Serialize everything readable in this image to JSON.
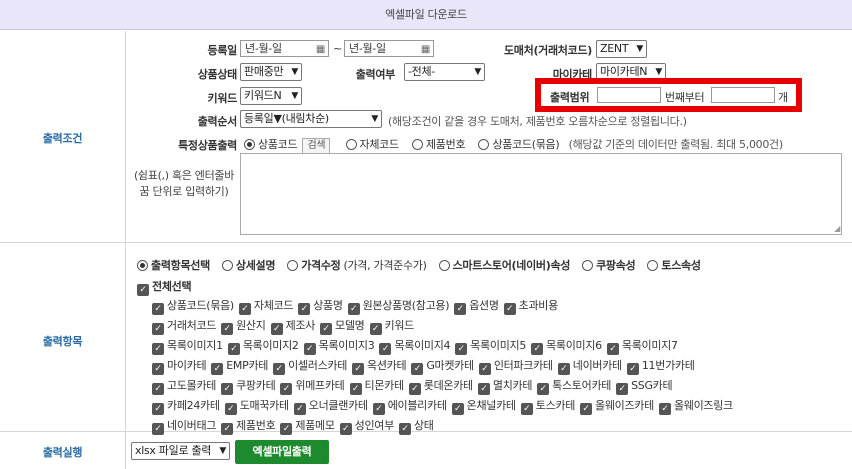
{
  "title": "엑셀파일 다운로드",
  "sections": {
    "condition": "출력조건",
    "items": "출력항목",
    "run": "출력실행"
  },
  "filters": {
    "reg_date_label": "등록일",
    "date_from_placeholder": "년-월-일",
    "tilde": "~",
    "date_to_placeholder": "년-월-일",
    "wholesaler_label": "도매처(거래처코드)",
    "wholesaler_value": "ZENT",
    "status_label": "상품상태",
    "status_value": "판매중만",
    "print_label": "출력여부",
    "print_value": "-전체-",
    "mycategory_label": "마이카테",
    "mycategory_value": "마이카테N",
    "keyword_label": "키워드",
    "keyword_value": "키워드N",
    "range_label": "출력범위",
    "range_from_suffix": "번째부터",
    "range_count_suffix": "개",
    "order_label": "출력순서",
    "order_value": "등록일▼(내림차순)",
    "order_note": "(해당조건이 같을 경우 도매처, 제품번호 오름차순으로 정렬됩니다.)",
    "special_label": "특정상품출력",
    "special_options": [
      "상품코드",
      "자체코드",
      "제품번호",
      "상품코드(묶음)"
    ],
    "search_button": "검색",
    "special_note": "(해당값 기준의 데이터만 출력됨. 최대 5,000건)",
    "textarea_hint_1": "(쉼표(,) 혹은 엔터줄바",
    "textarea_hint_2": "꿈 단위로 입력하기)"
  },
  "item_modes": [
    {
      "label": "출력항목선택",
      "selected": true
    },
    {
      "label": "상세설명",
      "selected": false
    },
    {
      "label": "가격수정",
      "note": "(가격, 가격준수가)",
      "selected": false
    },
    {
      "label": "스마트스토어(네이버)속성",
      "selected": false
    },
    {
      "label": "쿠팡속성",
      "selected": false
    },
    {
      "label": "토스속성",
      "selected": false
    }
  ],
  "select_all": "전체선택",
  "checkbox_rows": [
    [
      "상품코드(묶음)",
      "자체코드",
      "상품명",
      "원본상품명(참고용)",
      "옵션명",
      "초과비용"
    ],
    [
      "거래처코드",
      "원산지",
      "제조사",
      "모델명",
      "키워드"
    ],
    [
      "목록이미지1",
      "목록이미지2",
      "목록이미지3",
      "목록이미지4",
      "목록이미지5",
      "목록이미지6",
      "목록이미지7"
    ],
    [
      "마이카테",
      "EMP카테",
      "이셀러스카테",
      "옥션카테",
      "G마켓카테",
      "인터파크카테",
      "네이버카테",
      "11번가카테"
    ],
    [
      "고도몰카테",
      "쿠팡카테",
      "위메프카테",
      "티몬카테",
      "롯데온카테",
      "멸치카테",
      "톡스토어카테",
      "SSG카테"
    ],
    [
      "카페24카테",
      "도매꾹카테",
      "오너클랜카테",
      "에이블리카테",
      "온채널카테",
      "토스카테",
      "올웨이즈카테",
      "올웨이즈링크"
    ],
    [
      "네이버태그",
      "제품번호",
      "제품메모",
      "성인여부",
      "상태"
    ]
  ],
  "run": {
    "format_value": "xlsx 파일로 출력",
    "button": "엑셀파일출력"
  },
  "colors": {
    "header_bg": "#e8e6f8",
    "section_label": "#2b6ca3",
    "highlight": "#e80000",
    "button": "#1e8a2e"
  }
}
